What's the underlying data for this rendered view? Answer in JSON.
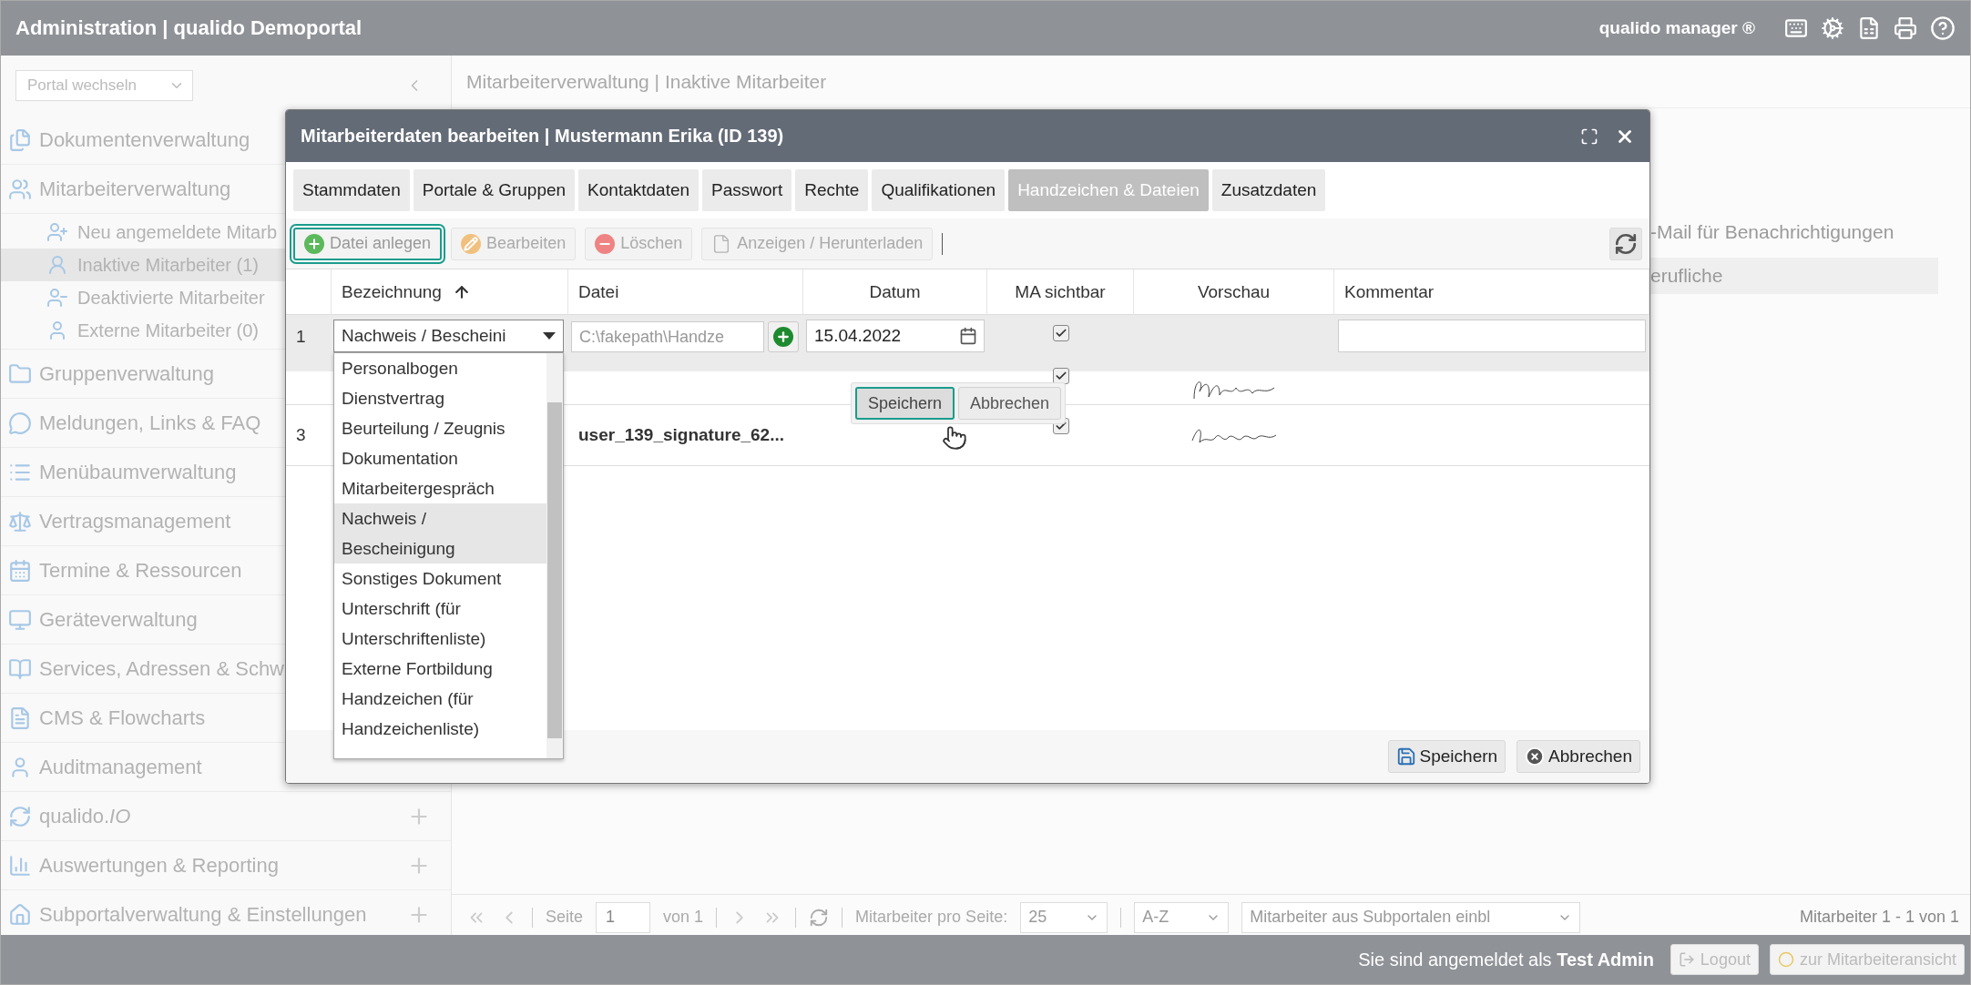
{
  "topbar": {
    "title": "Administration | qualido Demoportal",
    "brand": "qualido manager ®"
  },
  "sidebar": {
    "portal_select": "Portal wechseln",
    "items": [
      {
        "label": "Dokumentenverwaltung"
      },
      {
        "label": "Mitarbeiterverwaltung",
        "children": [
          {
            "label": "Neu angemeldete Mitarb",
            "selected": false
          },
          {
            "label": "Inaktive Mitarbeiter (1)",
            "selected": true
          },
          {
            "label": "Deaktivierte Mitarbeiter",
            "selected": false
          },
          {
            "label": "Externe Mitarbeiter (0)",
            "selected": false
          }
        ]
      },
      {
        "label": "Gruppenverwaltung"
      },
      {
        "label": "Meldungen, Links & FAQ"
      },
      {
        "label": "Menübaumverwaltung"
      },
      {
        "label": "Vertragsmanagement"
      },
      {
        "label": "Termine & Ressourcen"
      },
      {
        "label": "Geräteverwaltung"
      },
      {
        "label": "Services, Adressen & Schw"
      },
      {
        "label": "CMS & Flowcharts"
      },
      {
        "label": "Auditmanagement"
      },
      {
        "label": "qualido.*IO*",
        "expandable": true
      },
      {
        "label": "Auswertungen & Reporting",
        "expandable": true
      },
      {
        "label": "Subportalverwaltung & Einstellungen",
        "expandable": true
      }
    ]
  },
  "main": {
    "breadcrumb": "Mitarbeiterverwaltung | Inaktive Mitarbeiter",
    "background_lines": [
      {
        "text": "-Mail für Benachrichtigungen",
        "highlighted": false
      },
      {
        "text": "erufliche",
        "highlighted": true
      }
    ]
  },
  "pager": {
    "page_label": "Seite",
    "page": "1",
    "page_of": "von 1",
    "per_page_label": "Mitarbeiter pro Seite:",
    "per_page": "25",
    "sort": "A-Z",
    "subportals": "Mitarbeiter aus Subportalen einbl",
    "summary": "Mitarbeiter 1 - 1 von 1"
  },
  "footer": {
    "login_text": "Sie sind angemeldet als **Test Admin**",
    "buttons": [
      "Logout",
      "zur Mitarbeiteransicht"
    ]
  },
  "dialog": {
    "title": "Mitarbeiterdaten bearbeiten | Mustermann Erika (ID 139)",
    "tabs": [
      {
        "label": "Stammdaten",
        "selected": false
      },
      {
        "label": "Portale & Gruppen",
        "selected": false
      },
      {
        "label": "Kontaktdaten",
        "selected": false
      },
      {
        "label": "Passwort",
        "selected": false
      },
      {
        "label": "Rechte",
        "selected": false
      },
      {
        "label": "Qualifikationen",
        "selected": false
      },
      {
        "label": "Handzeichen & Dateien",
        "selected": true
      },
      {
        "label": "Zusatzdaten",
        "selected": false
      }
    ],
    "toolbar": [
      {
        "label": "Datei anlegen",
        "disabled": false,
        "focused": true
      },
      {
        "label": "Bearbeiten",
        "disabled": true,
        "focused": false
      },
      {
        "label": "Löschen",
        "disabled": true,
        "focused": false
      },
      {
        "label": "Anzeigen / Herunterladen",
        "disabled": true,
        "focused": false
      }
    ],
    "columns": [
      {
        "label": "Bezeichnung",
        "sorted": true
      },
      {
        "label": "Datei",
        "sorted": false
      },
      {
        "label": "Datum",
        "sorted": false
      },
      {
        "label": "MA sichtbar",
        "sorted": false
      },
      {
        "label": "Vorschau",
        "sorted": false
      },
      {
        "label": "Kommentar",
        "sorted": false
      }
    ],
    "edit_row": {
      "index": "1",
      "type": "Nachweis / Bescheini",
      "file": "C:\\fakepath\\Handze",
      "date": "15.04.2022",
      "visible": true
    },
    "rows": [
      {
        "visible": true
      },
      {
        "index": "3",
        "file": "user_139_signature_62...",
        "visible": true
      }
    ],
    "type_options": [
      {
        "label": "Personalbogen",
        "selected": false
      },
      {
        "label": "Dienstvertrag",
        "selected": false
      },
      {
        "label": "Beurteilung / Zeugnis",
        "selected": false
      },
      {
        "label": "Dokumentation",
        "selected": false
      },
      {
        "label": "Mitarbeitergespräch",
        "selected": false
      },
      {
        "label": "Nachweis / Bescheinigung",
        "selected": true
      },
      {
        "label": "Sonstiges Dokument",
        "selected": false
      },
      {
        "label": "Unterschrift (für Unterschriftenliste)",
        "selected": false
      },
      {
        "label": "Externe Fortbildung",
        "selected": false
      },
      {
        "label": "Handzeichen (für Handzeichenliste)",
        "selected": false
      }
    ],
    "row_actions": [
      {
        "label": "Speichern",
        "focused": true
      },
      {
        "label": "Abbrechen",
        "focused": false
      }
    ],
    "footer_buttons": [
      "Speichern",
      "Abbrechen"
    ]
  }
}
